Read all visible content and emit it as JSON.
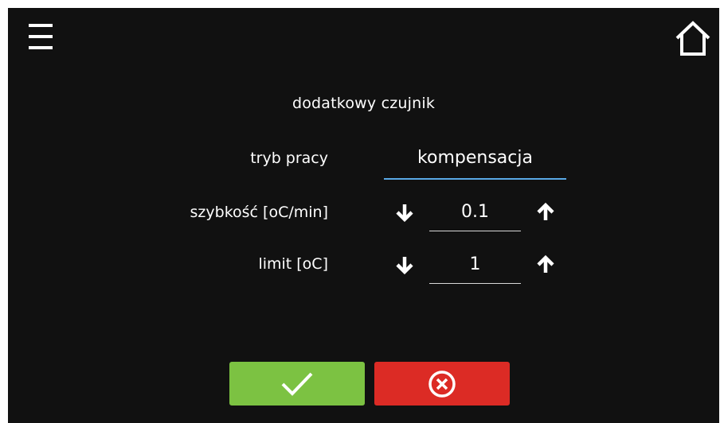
{
  "header": {
    "menu_icon": "hamburger-menu-icon",
    "home_icon": "home-icon"
  },
  "title": "dodatkowy czujnik",
  "mode": {
    "label": "tryb pracy",
    "value": "kompensacja"
  },
  "rate": {
    "label": "szybkość [oC/min]",
    "value": "0.1",
    "decrease_icon": "arrow-down-icon",
    "increase_icon": "arrow-up-icon"
  },
  "limit": {
    "label": "limit [oC]",
    "value": "1",
    "decrease_icon": "arrow-down-icon",
    "increase_icon": "arrow-up-icon"
  },
  "actions": {
    "confirm_icon": "checkmark-icon",
    "cancel_icon": "cancel-circle-x-icon"
  },
  "colors": {
    "background": "#111111",
    "confirm": "#7cc242",
    "cancel": "#dc2b25",
    "accent_underline": "#5aa9e6"
  }
}
